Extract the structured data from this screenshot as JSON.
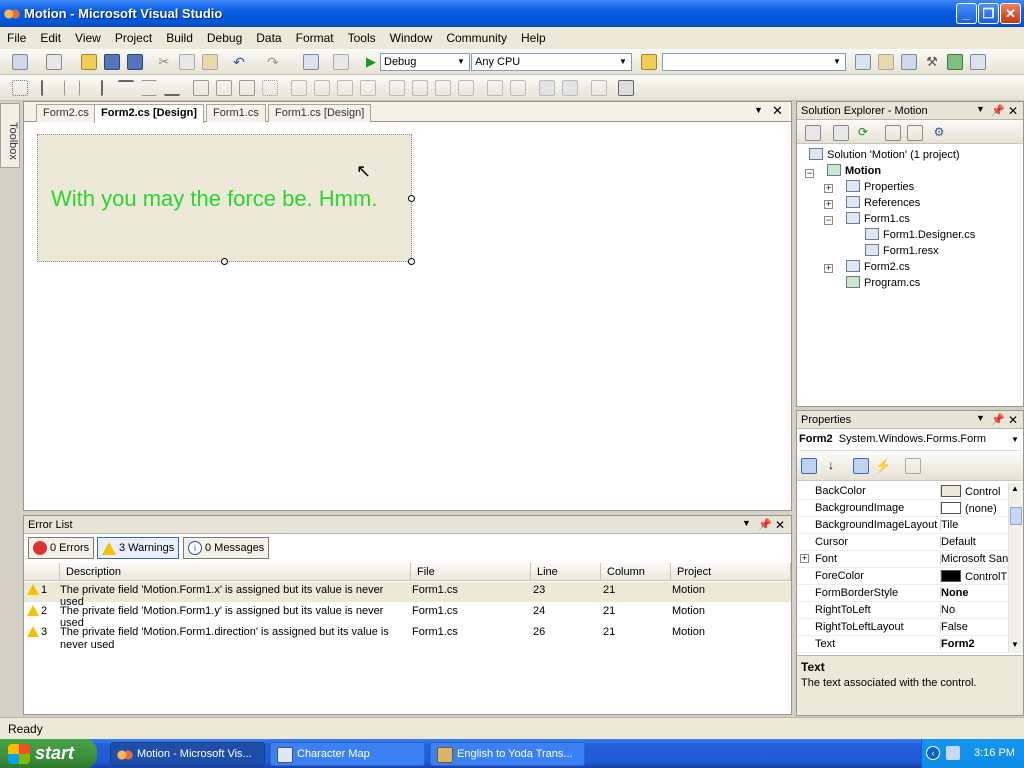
{
  "window": {
    "title": "Motion - Microsoft Visual Studio"
  },
  "menu": [
    "File",
    "Edit",
    "View",
    "Project",
    "Build",
    "Debug",
    "Data",
    "Format",
    "Tools",
    "Window",
    "Community",
    "Help"
  ],
  "toolbar": {
    "config": "Debug",
    "platform": "Any CPU",
    "search": ""
  },
  "toolbox_label": "Toolbox",
  "tabs": [
    "Form2.cs",
    "Form2.cs [Design]",
    "Form1.cs",
    "Form1.cs [Design]"
  ],
  "active_tab_index": 1,
  "designer": {
    "label_text": "With you may the force be. Hmm.",
    "label_color": "#2bd52b"
  },
  "solution_explorer": {
    "title": "Solution Explorer - Motion",
    "items": [
      {
        "label": "Solution 'Motion' (1 project)",
        "bold": false
      },
      {
        "label": "Motion",
        "bold": true
      },
      {
        "label": "Properties"
      },
      {
        "label": "References"
      },
      {
        "label": "Form1.cs"
      },
      {
        "label": "Form1.Designer.cs"
      },
      {
        "label": "Form1.resx"
      },
      {
        "label": "Form2.cs"
      },
      {
        "label": "Program.cs"
      }
    ]
  },
  "properties": {
    "title": "Properties",
    "object_name": "Form2",
    "object_type": "System.Windows.Forms.Form",
    "rows": [
      {
        "name": "BackColor",
        "value": "Control",
        "swatch": "#ece9d8"
      },
      {
        "name": "BackgroundImage",
        "value": "(none)",
        "swatch": "#ffffff"
      },
      {
        "name": "BackgroundImageLayout",
        "value": "Tile"
      },
      {
        "name": "Cursor",
        "value": "Default"
      },
      {
        "name": "Font",
        "value": "Microsoft San"
      },
      {
        "name": "ForeColor",
        "value": "ControlT",
        "swatch": "#000000"
      },
      {
        "name": "FormBorderStyle",
        "value": "None",
        "bold": true
      },
      {
        "name": "RightToLeft",
        "value": "No"
      },
      {
        "name": "RightToLeftLayout",
        "value": "False"
      },
      {
        "name": "Text",
        "value": "Form2",
        "bold": true
      }
    ],
    "desc_title": "Text",
    "desc_body": "The text associated with the control."
  },
  "error_list": {
    "title": "Error List",
    "errors_btn": "0 Errors",
    "warnings_btn": "3 Warnings",
    "messages_btn": "0 Messages",
    "columns": [
      "Description",
      "File",
      "Line",
      "Column",
      "Project"
    ],
    "rows": [
      {
        "n": "1",
        "desc": "The private field 'Motion.Form1.x' is assigned but its value is never used",
        "file": "Form1.cs",
        "line": "23",
        "col": "21",
        "project": "Motion"
      },
      {
        "n": "2",
        "desc": "The private field 'Motion.Form1.y' is assigned but its value is never used",
        "file": "Form1.cs",
        "line": "24",
        "col": "21",
        "project": "Motion"
      },
      {
        "n": "3",
        "desc": "The private field 'Motion.Form1.direction' is assigned but its value is never used",
        "file": "Form1.cs",
        "line": "26",
        "col": "21",
        "project": "Motion"
      }
    ]
  },
  "status": "Ready",
  "taskbar": {
    "start": "start",
    "tasks": [
      "Motion - Microsoft Vis...",
      "Character Map",
      "English to Yoda Trans..."
    ],
    "clock": "3:16 PM"
  }
}
